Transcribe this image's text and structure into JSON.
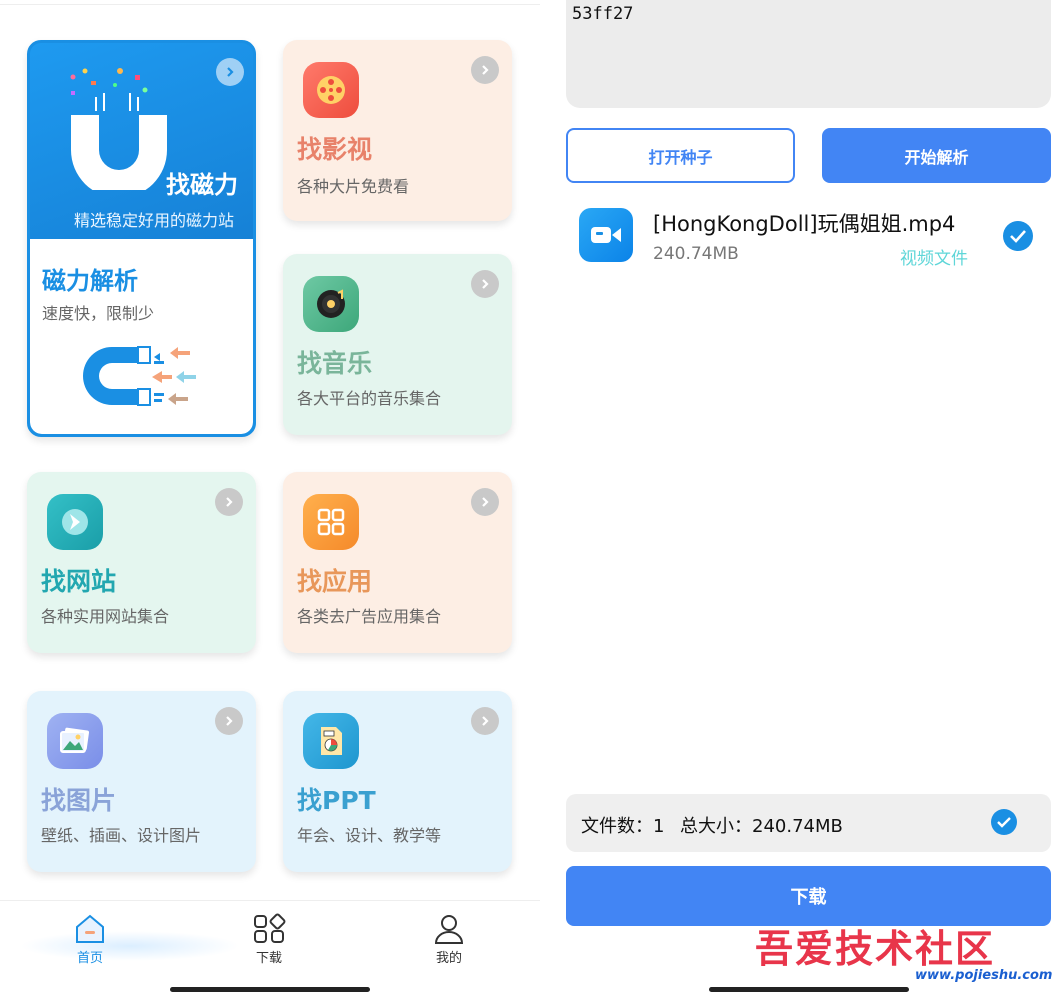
{
  "left": {
    "magnet_card": {
      "title": "找磁力",
      "subtitle": "精选稳定好用的磁力站",
      "section_title": "磁力解析",
      "section_subtitle": "速度快，限制少"
    },
    "cards": [
      {
        "title": "找影视",
        "subtitle": "各种大片免费看"
      },
      {
        "title": "找音乐",
        "subtitle": "各大平台的音乐集合"
      },
      {
        "title": "找网站",
        "subtitle": "各种实用网站集合"
      },
      {
        "title": "找应用",
        "subtitle": "各类去广告应用集合"
      },
      {
        "title": "找图片",
        "subtitle": "壁纸、插画、设计图片"
      },
      {
        "title": "找PPT",
        "subtitle": "年会、设计、教学等"
      }
    ],
    "nav": [
      {
        "label": "首页"
      },
      {
        "label": "下载"
      },
      {
        "label": "我的"
      }
    ]
  },
  "right": {
    "hash_text": "53ff27",
    "open_torrent_label": "打开种子",
    "start_parse_label": "开始解析",
    "file": {
      "name": "[HongKongDoll]玩偶姐姐.mp4",
      "size": "240.74MB",
      "type": "视频文件"
    },
    "summary": {
      "count_label": "文件数：1",
      "total_label": "总大小：240.74MB"
    },
    "download_label": "下载"
  },
  "watermark": {
    "text": "吾爱技术社区",
    "url": "www.pojieshu.com"
  },
  "colors": {
    "primary_blue": "#4285f4",
    "magnet_blue": "#1a8fe3",
    "movie_bg": "#fdeee4",
    "music_bg": "#e4f5ee",
    "site_bg": "#e4f6ef",
    "app_bg": "#fdeee4",
    "image_bg": "#e3f3fc",
    "ppt_bg": "#e3f3fc"
  }
}
